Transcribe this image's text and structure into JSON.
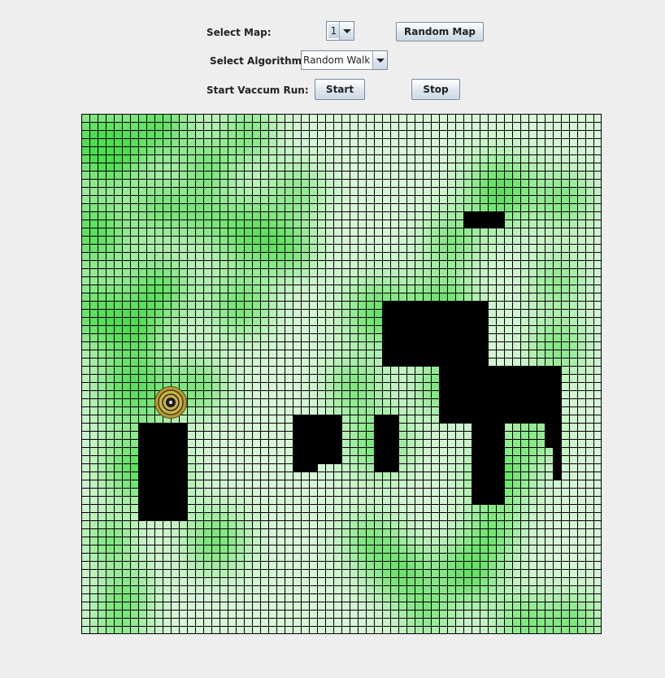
{
  "controls": {
    "map_label": "Select Map:",
    "map_selected": "1",
    "random_map_button": "Random Map",
    "algorithm_label": "Select Algorithm:",
    "algorithm_selected": "Random Walk",
    "run_label": "Start Vaccum Run:",
    "start_button": "Start",
    "stop_button": "Stop"
  },
  "grid": {
    "rows": 64,
    "cols": 64,
    "colors": {
      "clean": "#d8f5d8",
      "dirty": "#4edd4e",
      "obstacle": "#000000",
      "line": "#000000"
    },
    "obstacles": [
      [
        47,
        12,
        51,
        13
      ],
      [
        37,
        23,
        49,
        30
      ],
      [
        44,
        31,
        58,
        37
      ],
      [
        48,
        38,
        51,
        47
      ],
      [
        57,
        38,
        58,
        40
      ],
      [
        58,
        41,
        58,
        44
      ],
      [
        7,
        38,
        12,
        49
      ],
      [
        26,
        37,
        31,
        42
      ],
      [
        26,
        43,
        28,
        43
      ],
      [
        36,
        37,
        38,
        43
      ]
    ],
    "dirt_spots": [
      [
        1,
        3,
        3.2,
        0.9
      ],
      [
        1,
        14,
        3.2,
        0.9
      ],
      [
        1,
        24,
        3.0,
        0.8
      ],
      [
        4,
        5,
        2.5,
        0.5
      ],
      [
        3,
        52,
        2.2,
        0.6
      ],
      [
        4,
        62,
        2.5,
        0.5
      ],
      [
        9,
        1,
        3.0,
        0.8
      ],
      [
        9,
        11,
        2.5,
        0.6
      ],
      [
        9,
        21,
        3.0,
        0.8
      ],
      [
        6,
        33,
        3.5,
        0.9
      ],
      [
        6,
        43,
        3.0,
        0.8
      ],
      [
        5,
        58,
        2.5,
        0.5
      ],
      [
        20,
        2,
        2.5,
        0.6
      ],
      [
        20,
        14,
        3.0,
        0.8
      ],
      [
        19,
        23,
        2.8,
        0.7
      ],
      [
        14,
        33,
        2.5,
        0.6
      ],
      [
        14,
        12,
        2.5,
        0.5
      ],
      [
        25,
        16,
        2.5,
        0.6
      ],
      [
        36,
        24,
        3.0,
        0.8
      ],
      [
        36,
        40,
        2.8,
        0.7
      ],
      [
        44,
        23,
        2.8,
        0.8
      ],
      [
        35,
        52,
        2.5,
        0.6
      ],
      [
        39,
        56,
        2.8,
        0.7
      ],
      [
        47,
        56,
        2.8,
        0.8
      ],
      [
        51,
        44,
        2.8,
        0.8
      ],
      [
        50,
        51,
        2.5,
        0.6
      ],
      [
        44,
        33,
        2.5,
        0.7
      ],
      [
        45,
        15,
        2.5,
        0.6
      ],
      [
        51,
        9,
        3.0,
        0.9
      ],
      [
        59,
        10,
        2.5,
        0.6
      ],
      [
        58,
        28,
        2.5,
        0.6
      ],
      [
        55,
        39,
        2.5,
        0.5
      ],
      [
        54,
        62,
        2.5,
        0.6
      ],
      [
        60,
        62,
        2.5,
        0.6
      ],
      [
        42,
        61,
        2.2,
        0.5
      ],
      [
        16,
        52,
        2.8,
        0.7
      ],
      [
        10,
        44,
        2.2,
        0.5
      ],
      [
        15,
        6,
        2.5,
        0.6
      ],
      [
        26,
        9,
        2.5,
        0.5
      ],
      [
        58,
        20,
        2.5,
        0.5
      ],
      [
        33,
        33,
        2.5,
        0.6
      ],
      [
        6,
        26,
        2.5,
        0.6
      ]
    ],
    "robot": {
      "col": 11,
      "row": 35,
      "icon": "robot-vacuum-icon"
    }
  }
}
